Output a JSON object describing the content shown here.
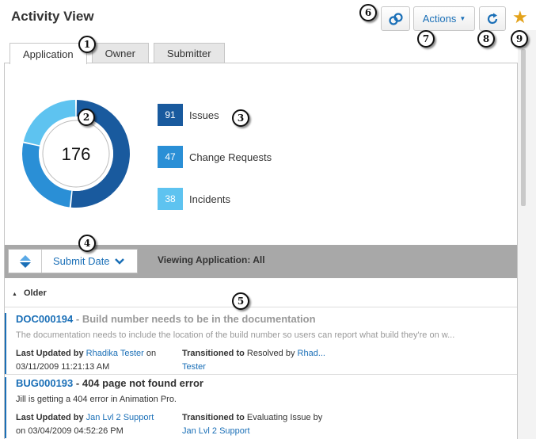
{
  "header": {
    "title": "Activity View",
    "actions_label": "Actions"
  },
  "tabs": [
    {
      "label": "Application",
      "active": true
    },
    {
      "label": "Owner",
      "active": false
    },
    {
      "label": "Submitter",
      "active": false
    }
  ],
  "chart_data": {
    "type": "pie",
    "categories": [
      "Issues",
      "Change Requests",
      "Incidents"
    ],
    "values": [
      91,
      47,
      38
    ],
    "total": "176",
    "colors": [
      "#195a9e",
      "#2a8fd6",
      "#5ec3f0"
    ]
  },
  "legend": [
    {
      "value": "91",
      "label": "Issues",
      "color": "#195a9e"
    },
    {
      "value": "47",
      "label": "Change Requests",
      "color": "#2a8fd6"
    },
    {
      "value": "38",
      "label": "Incidents",
      "color": "#5ec3f0"
    }
  ],
  "toolbar": {
    "sort_label": "Submit Date",
    "viewing_text": "Viewing Application: All"
  },
  "group": {
    "label": "Older"
  },
  "records": [
    {
      "id": "DOC000194",
      "summary": "- Build number needs to be in the documentation",
      "description": "The documentation needs to include the location of the build number so users can report what build they're on w...",
      "updated_label": "Last Updated by",
      "updated_by": "Rhadika Tester",
      "updated_on_word": "on",
      "updated_date": "03/11/2009 11:21:13 AM",
      "transition_label": "Transitioned to",
      "transition_state": "Resolved by",
      "transition_by": "Rhad...",
      "transition_by_line2": "Tester"
    },
    {
      "id": "BUG000193",
      "summary": "- 404 page not found error",
      "description": "Jill is getting a 404 error in Animation Pro.",
      "updated_label": "Last Updated by",
      "updated_by": "Jan Lvl 2 Support",
      "updated_on_word": "on",
      "updated_date": "03/04/2009 04:52:26 PM",
      "transition_label": "Transitioned to",
      "transition_state": "Evaluating Issue by",
      "transition_by": "",
      "transition_by_line2": "Jan Lvl 2 Support"
    }
  ],
  "callouts": [
    "1",
    "2",
    "3",
    "4",
    "5",
    "6",
    "7",
    "8",
    "9"
  ]
}
